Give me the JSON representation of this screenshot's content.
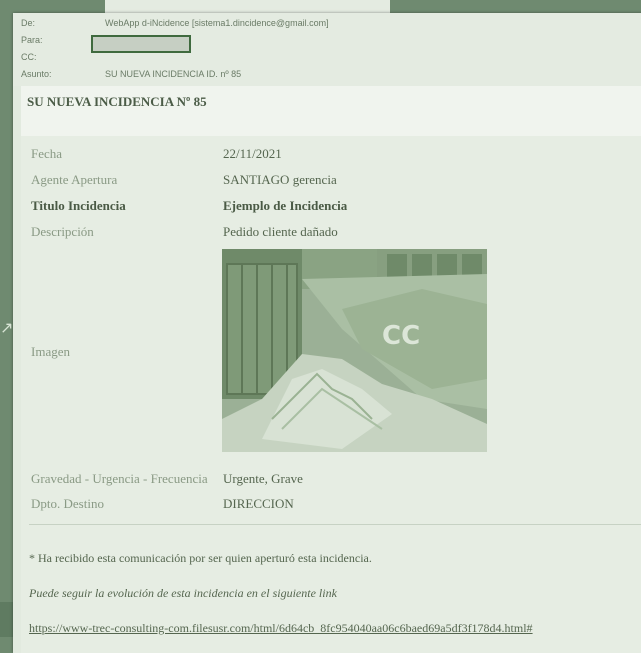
{
  "header": {
    "de_label": "De:",
    "de_value": "WebApp d-iNcidence [sistema1.dincidence@gmail.com]",
    "para_label": "Para:",
    "cc_label": "CC:",
    "asunto_label": "Asunto:",
    "asunto_value": "SU NUEVA INCIDENCIA ID. nº 85"
  },
  "title": "SU NUEVA INCIDENCIA Nº 85",
  "fields": {
    "fecha_label": "Fecha",
    "fecha_value": "22/11/2021",
    "agente_label": "Agente Apertura",
    "agente_value": "SANTIAGO gerencia",
    "titulo_label": "Titulo Incidencia",
    "titulo_value": "Ejemplo de Incidencia",
    "desc_label": "Descripción",
    "desc_value": "Pedido cliente dañado",
    "imagen_label": "Imagen",
    "gravedad_label": "Gravedad - Urgencia - Frecuencia",
    "gravedad_value": "Urgente, Grave",
    "dpto_label": "Dpto. Destino",
    "dpto_value": "DIRECCION"
  },
  "footer": {
    "note1": "* Ha recibido esta comunicación por ser quien aperturó esta incidencia.",
    "note2": "Puede seguir la evolución de esta incidencia en el siguiente link",
    "link": "https://www-trec-consulting-com.filesusr.com/html/6d64cb_8fc954040aa06c6baed69a5df3f178d4.html#"
  }
}
